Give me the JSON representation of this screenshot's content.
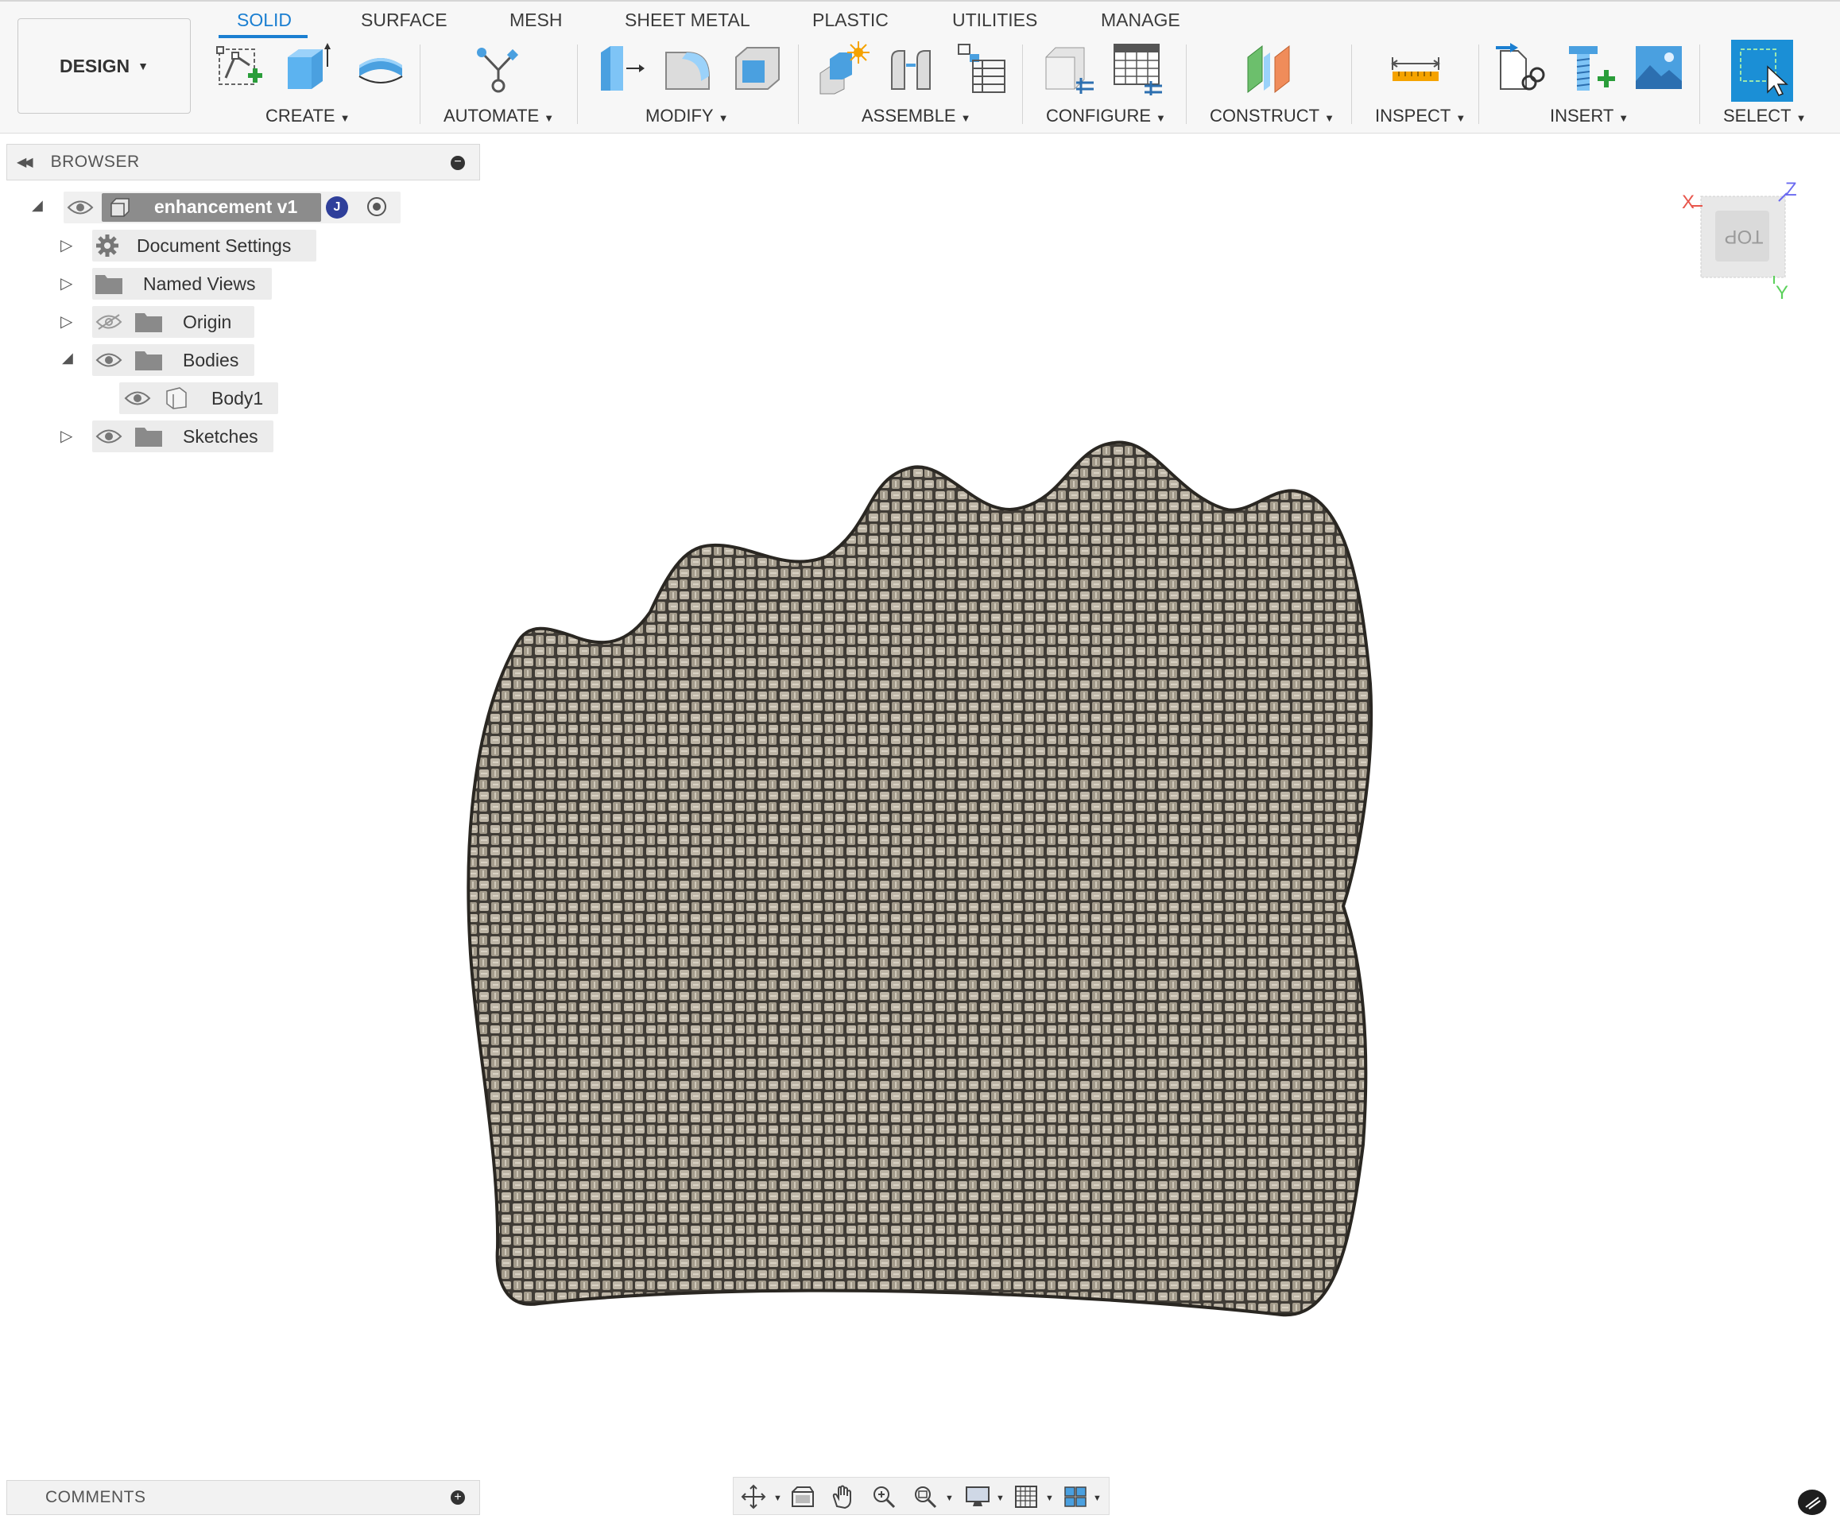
{
  "toolbar": {
    "workspace": "DESIGN",
    "tabs": [
      {
        "label": "SOLID",
        "active": true
      },
      {
        "label": "SURFACE",
        "active": false
      },
      {
        "label": "MESH",
        "active": false
      },
      {
        "label": "SHEET METAL",
        "active": false
      },
      {
        "label": "PLASTIC",
        "active": false
      },
      {
        "label": "UTILITIES",
        "active": false
      },
      {
        "label": "MANAGE",
        "active": false
      }
    ],
    "groups": [
      {
        "label": "CREATE",
        "icons": [
          "create-sketch-icon",
          "extrude-icon",
          "revolve-icon"
        ]
      },
      {
        "label": "AUTOMATE",
        "icons": [
          "automate-icon"
        ]
      },
      {
        "label": "MODIFY",
        "icons": [
          "press-pull-icon",
          "fillet-icon",
          "shell-icon"
        ]
      },
      {
        "label": "ASSEMBLE",
        "icons": [
          "new-component-icon",
          "joint-icon",
          "bom-table-icon"
        ]
      },
      {
        "label": "CONFIGURE",
        "icons": [
          "configure-model-icon",
          "configure-table-icon"
        ]
      },
      {
        "label": "CONSTRUCT",
        "icons": [
          "offset-plane-icon"
        ]
      },
      {
        "label": "INSPECT",
        "icons": [
          "measure-icon"
        ]
      },
      {
        "label": "INSERT",
        "icons": [
          "insert-derive-icon",
          "insert-mcmaster-icon",
          "insert-canvas-icon"
        ]
      },
      {
        "label": "SELECT",
        "icons": [
          "window-select-icon"
        ]
      }
    ],
    "accent_color": "#1b7fd1"
  },
  "browser": {
    "title": "BROWSER",
    "root": {
      "label": "enhancement v1",
      "user_initial": "J"
    },
    "items": [
      {
        "label": "Document Settings"
      },
      {
        "label": "Named Views"
      },
      {
        "label": "Origin"
      },
      {
        "label": "Bodies"
      },
      {
        "label": "Body1"
      },
      {
        "label": "Sketches"
      }
    ]
  },
  "viewcube": {
    "face": "TOP",
    "axes": {
      "x": "X",
      "y": "Y",
      "z": "Z"
    },
    "axis_colors": {
      "x": "#e8564c",
      "y": "#5bd15b",
      "z": "#6a6af0"
    }
  },
  "model": {
    "material": "woven-fabric-texture",
    "fill_color": "#b3ab9c",
    "weave_dark": "#403c36"
  },
  "comments": {
    "title": "COMMENTS"
  },
  "navbar": {
    "icons": [
      "orbit-icon",
      "look-at-icon",
      "pan-icon",
      "zoom-icon",
      "zoom-window-icon",
      "display-settings-icon",
      "grid-icon",
      "viewports-icon"
    ]
  }
}
